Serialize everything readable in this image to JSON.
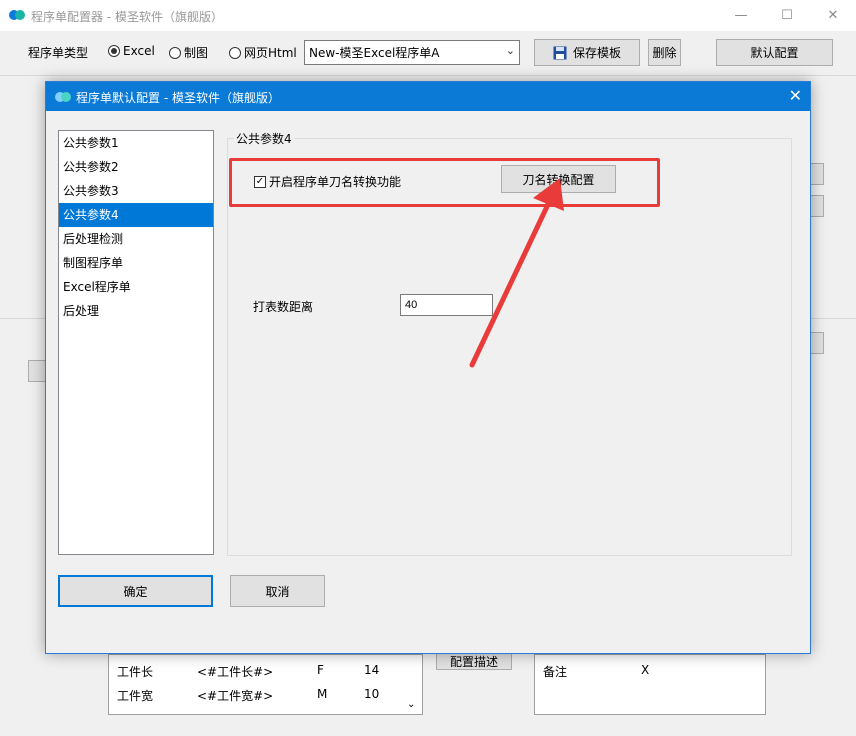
{
  "main_window": {
    "title": "程序单配置器 - 模圣软件（旗舰版）",
    "toolbar": {
      "type_label": "程序单类型",
      "radio_excel": "Excel",
      "radio_drawing": "制图",
      "radio_html": "网页Html",
      "selected_type": "Excel",
      "template_value": "New-模圣Excel程序单A",
      "save_template": "保存模板",
      "delete": "删除",
      "default_config": "默认配置"
    },
    "background": {
      "rows": [
        {
          "name": "工件长",
          "code": "<#工件长#>",
          "letter": "F",
          "value": "14"
        },
        {
          "name": "工件宽",
          "code": "<#工件宽#>",
          "letter": "M",
          "value": "10"
        }
      ],
      "config_desc": "配置描述",
      "remark": "备注",
      "remark_value": "X"
    }
  },
  "dialog": {
    "title": "程序单默认配置 - 模圣软件（旗舰版）",
    "categories": [
      "公共参数1",
      "公共参数2",
      "公共参数3",
      "公共参数4",
      "后处理检测",
      "制图程序单",
      "Excel程序单",
      "后处理"
    ],
    "selected_category": "公共参数4",
    "group_title": "公共参数4",
    "enable_tool_rename": "开启程序单刀名转换功能",
    "enable_tool_rename_checked": true,
    "tool_rename_config": "刀名转换配置",
    "table_distance_label": "打表数距离",
    "table_distance_value": "40",
    "ok": "确定",
    "cancel": "取消"
  },
  "colors": {
    "accent": "#0a7ad6",
    "selection": "#0078d7",
    "annotation": "#ea3b3b"
  }
}
